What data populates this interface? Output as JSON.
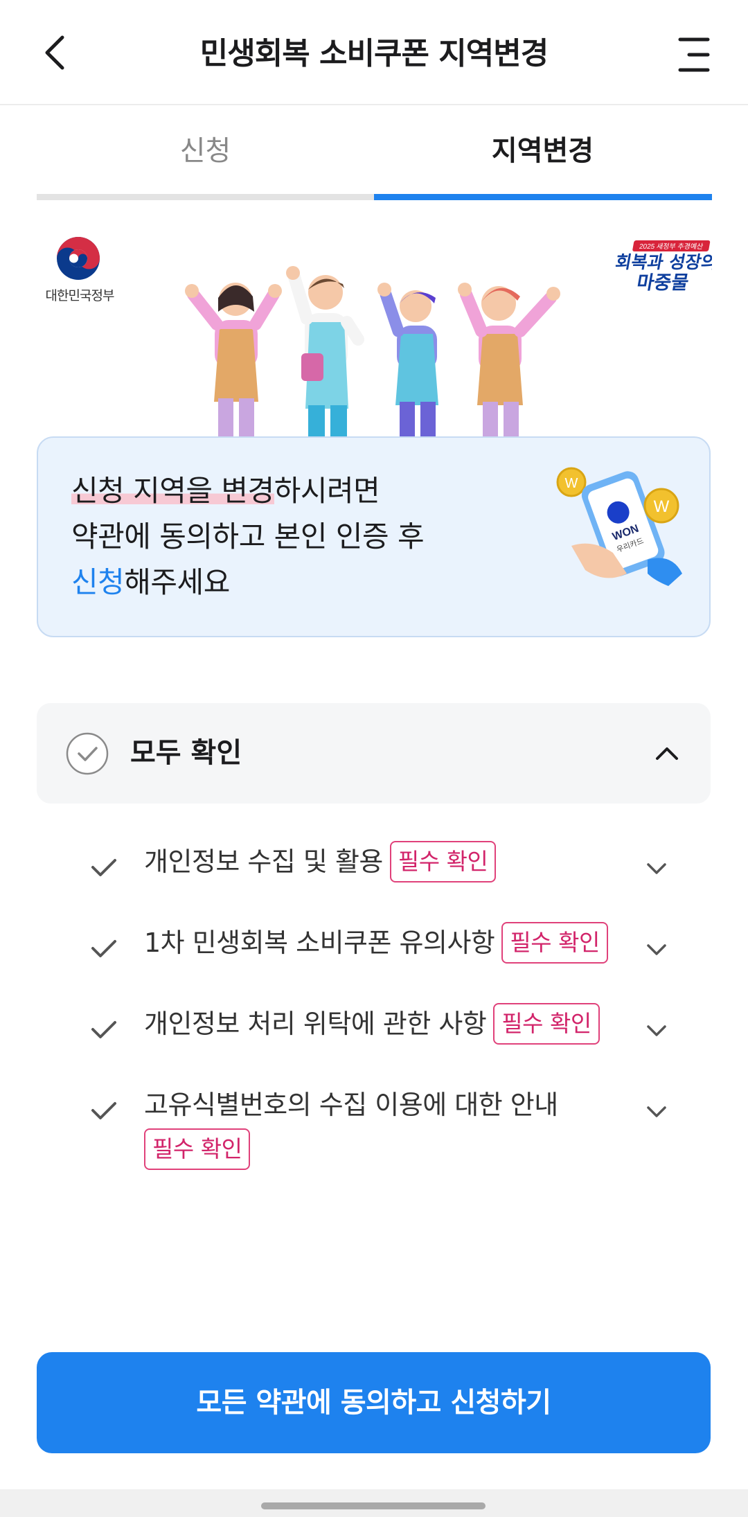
{
  "header": {
    "title": "민생회복 소비쿠폰 지역변경",
    "back_icon": "chevron-left-icon",
    "menu_icon": "hamburger-menu-icon"
  },
  "tabs": [
    {
      "label": "신청",
      "selected": false
    },
    {
      "label": "지역변경",
      "selected": true
    }
  ],
  "banner": {
    "gov_name": "대한민국정부",
    "slogan_top": "2025 새정부 추경예산",
    "slogan_line1": "회복과 성장의",
    "slogan_line2": "마중물"
  },
  "info": {
    "line1_highlight": "신청 지역을 변경",
    "line1_rest": "하시려면",
    "line2": "약관에 동의하고 본인 인증 후",
    "line3_blue": "신청",
    "line3_rest": "해주세요",
    "phone_brand": "WON",
    "phone_sub": "우리카드"
  },
  "agree_all": {
    "label": "모두 확인",
    "checked": false
  },
  "terms": [
    {
      "label": "개인정보 수집 및 활용",
      "badge": "필수 확인"
    },
    {
      "label": "1차 민생회복 소비쿠폰 유의사항",
      "badge": "필수 확인"
    },
    {
      "label": "개인정보 처리 위탁에 관한 사항",
      "badge": "필수 확인"
    },
    {
      "label": "고유식별번호의 수집 이용에 대한 안내",
      "badge": "필수 확인"
    }
  ],
  "cta": {
    "label": "모든 약관에 동의하고 신청하기"
  },
  "colors": {
    "primary": "#1e82ee",
    "badge": "#d2246a",
    "info_bg": "#eaf3fd"
  }
}
